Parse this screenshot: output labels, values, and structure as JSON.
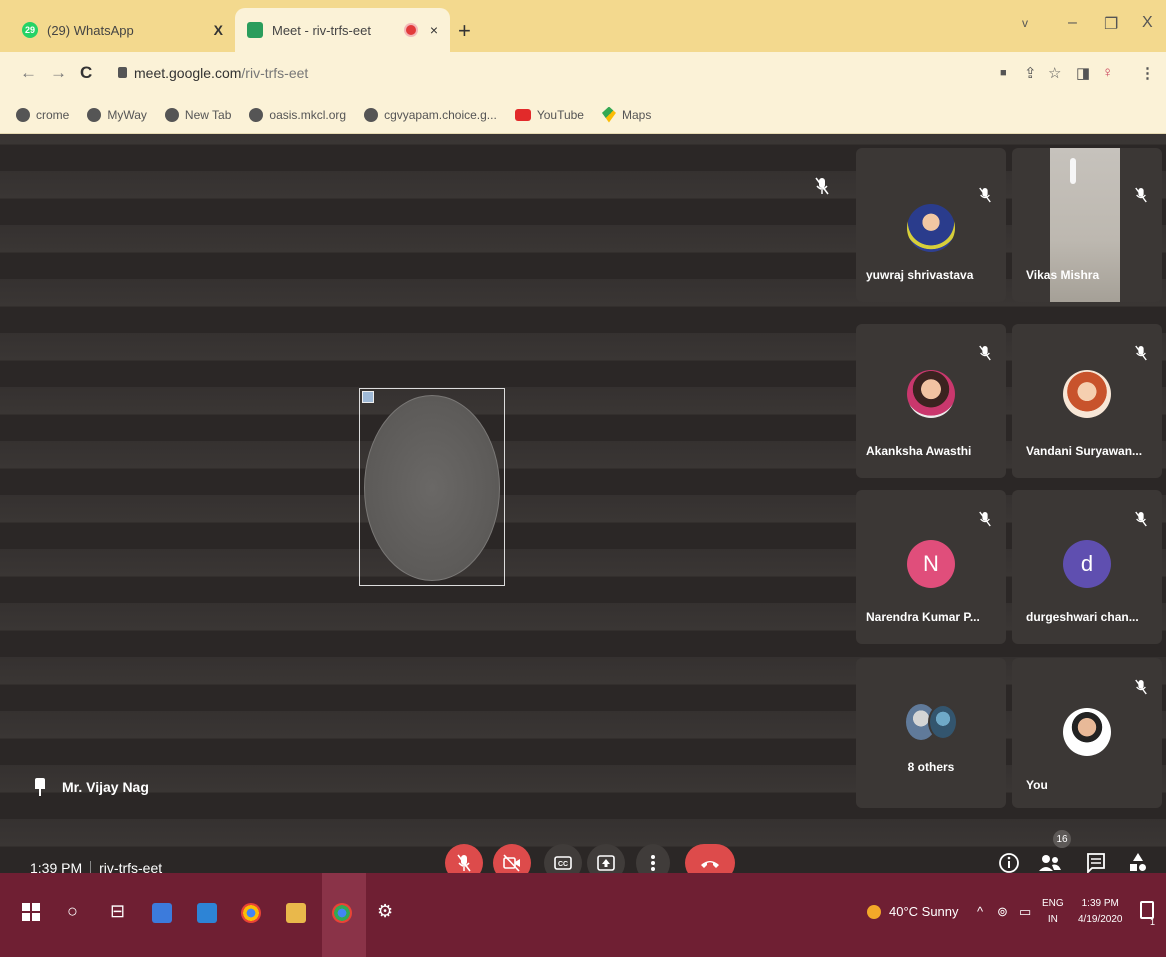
{
  "browser": {
    "tabs": [
      {
        "label": "(29) WhatsApp",
        "icon": "whatsapp-icon",
        "badge": "29"
      },
      {
        "label": "Meet - riv-trfs-eet",
        "icon": "meet-icon"
      }
    ],
    "new_tab": "+",
    "window_controls": {
      "dropdown": "v",
      "minimize": "–",
      "restore": "❐",
      "close": "X"
    },
    "url": {
      "host": "meet.google.com",
      "path": "/riv-trfs-eet"
    },
    "bookmarks": [
      "crome",
      "MyWay",
      "New Tab",
      "oasis.mkcl.org",
      "cgvyapam.choice.g...",
      "YouTube",
      "Maps"
    ]
  },
  "meet": {
    "presenter": "Mr. Vijay Nag",
    "participants": [
      {
        "name": "yuwraj shrivastava",
        "avatar": "photo"
      },
      {
        "name": "Vikas Mishra",
        "avatar": "video"
      },
      {
        "name": "Akanksha Awasthi",
        "avatar": "photo"
      },
      {
        "name": "Vandani Suryawan...",
        "avatar": "photo"
      },
      {
        "name": "Narendra Kumar P...",
        "avatar": "letter",
        "letter": "N",
        "color": "#e04e7b"
      },
      {
        "name": "durgeshwari chan...",
        "avatar": "letter",
        "letter": "d",
        "color": "#5f4fb0"
      },
      {
        "name": "8 others",
        "avatar": "group"
      },
      {
        "name": "You",
        "avatar": "photo"
      }
    ],
    "time": "1:39 PM",
    "meeting_code": "riv-trfs-eet",
    "people_count": "16",
    "colors": {
      "danger": "#dd4b4b",
      "stage": "#2f2b29",
      "tile": "#3b3735"
    }
  },
  "taskbar": {
    "weather": "40°C Sunny",
    "lang": [
      "ENG",
      "IN"
    ],
    "time": "1:39 PM",
    "date": "4/19/2020",
    "notifications": "1",
    "color": "#6f1f33"
  }
}
